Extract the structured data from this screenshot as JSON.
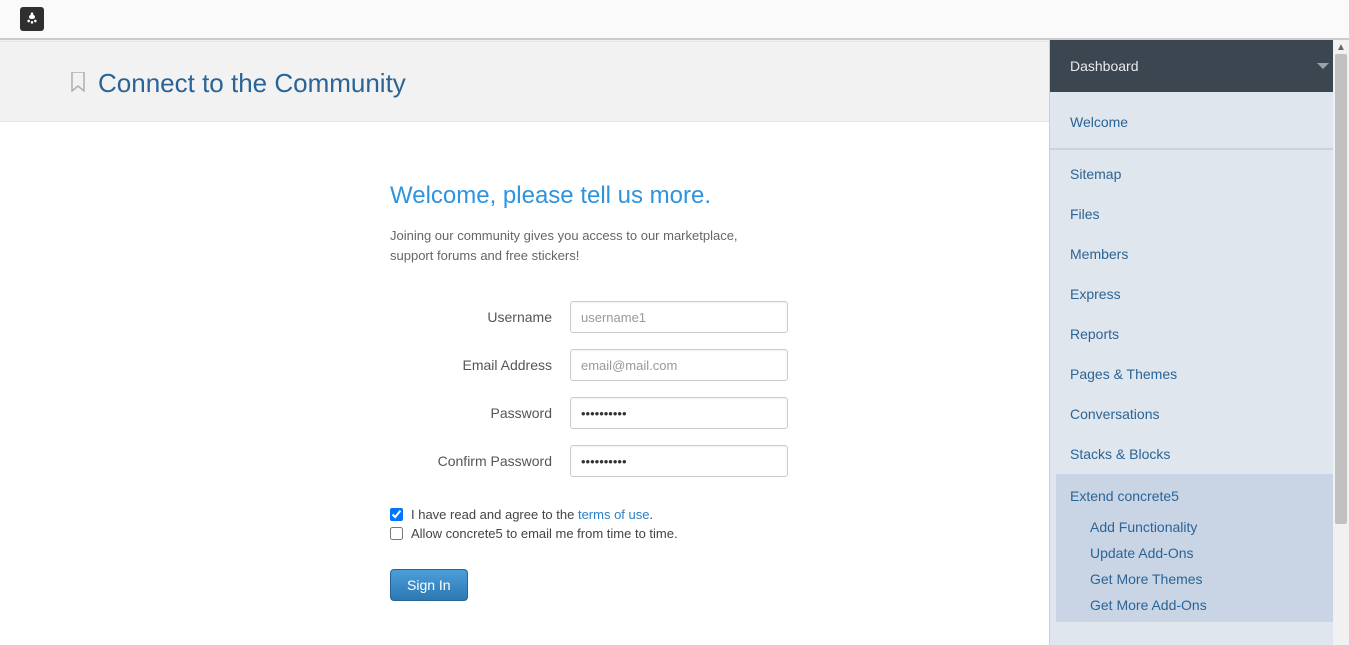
{
  "hero": {
    "title": "Connect to the Community"
  },
  "form": {
    "title": "Welcome, please tell us more.",
    "subtitle": "Joining our community gives you access to our marketplace, support forums and free stickers!",
    "labels": {
      "username": "Username",
      "email": "Email Address",
      "password": "Password",
      "confirm": "Confirm Password"
    },
    "placeholders": {
      "username": "username1",
      "email": "email@mail.com"
    },
    "checks": {
      "agree_pre": "I have read and agree to the ",
      "agree_link": "terms of use",
      "agree_post": ".",
      "allow": "Allow concrete5 to email me from time to time."
    },
    "submit": "Sign In"
  },
  "sidebar": {
    "header": "Dashboard",
    "welcome": "Welcome",
    "items": [
      "Sitemap",
      "Files",
      "Members",
      "Express",
      "Reports",
      "Pages & Themes",
      "Conversations",
      "Stacks & Blocks"
    ],
    "extend": {
      "label": "Extend concrete5",
      "children": [
        "Add Functionality",
        "Update Add-Ons",
        "Get More Themes",
        "Get More Add-Ons"
      ]
    }
  }
}
